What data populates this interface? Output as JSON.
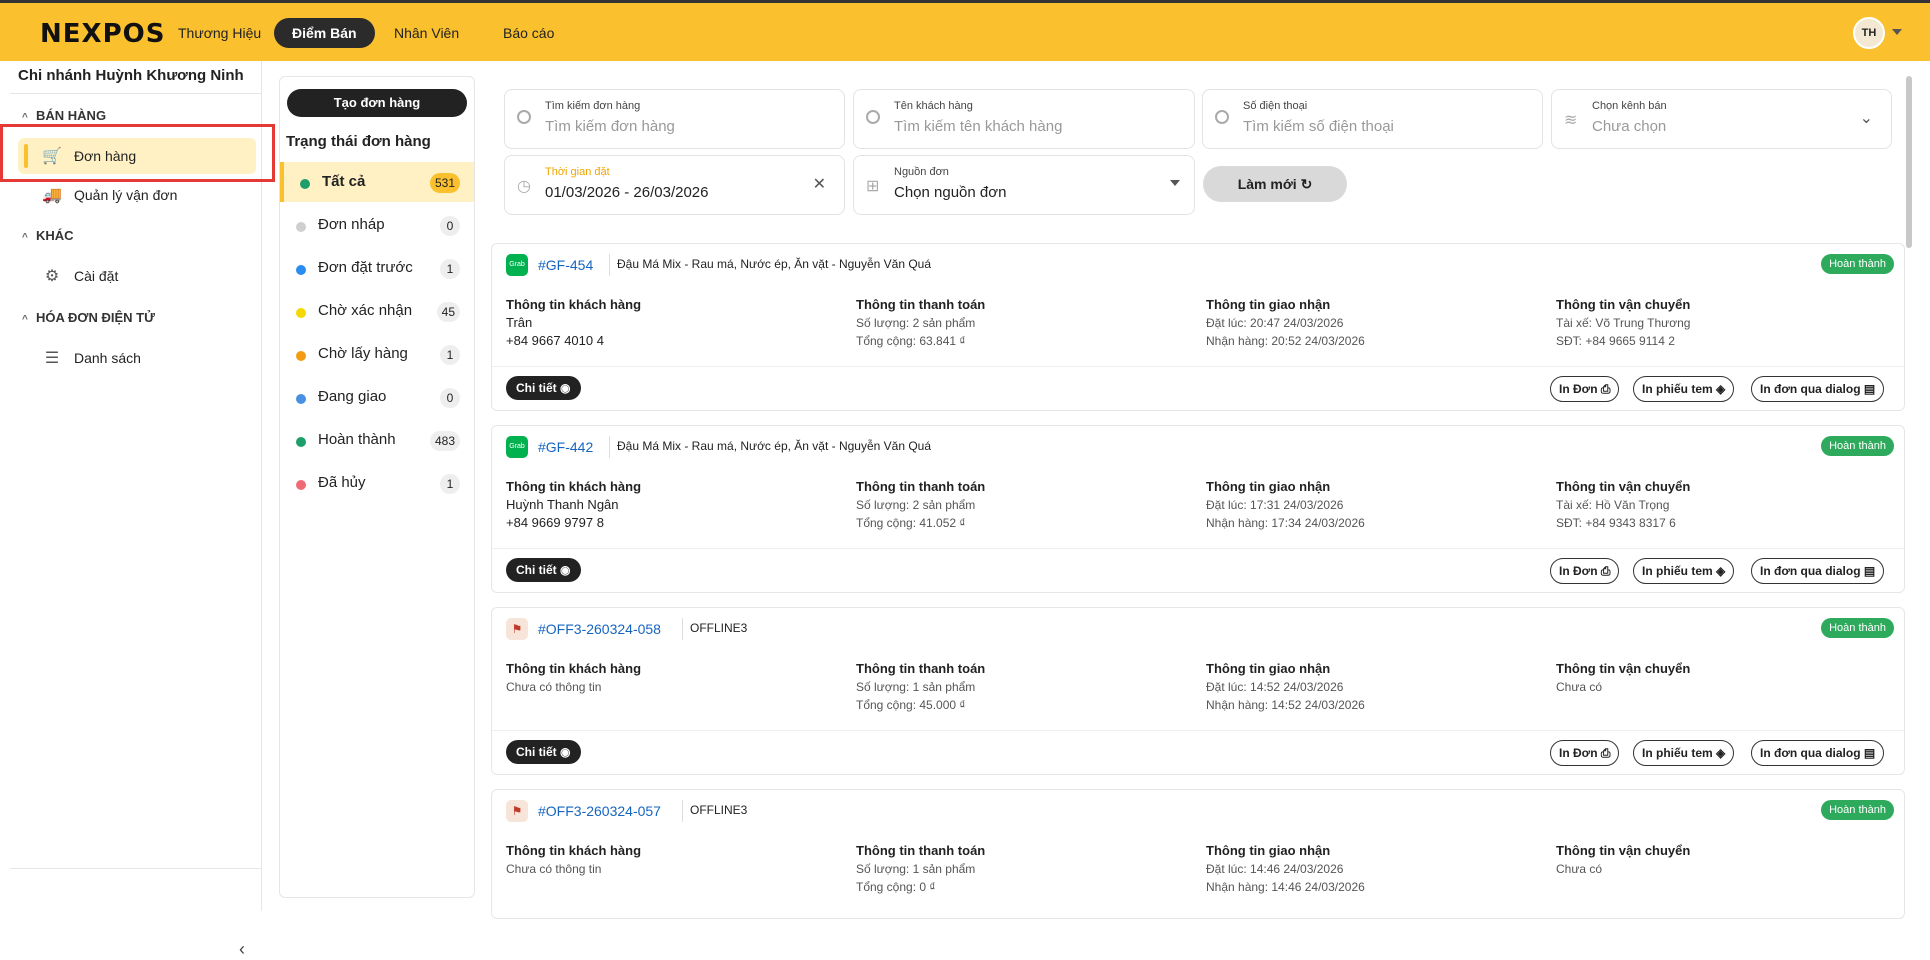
{
  "topbar": {
    "logo": "NEXPOS",
    "nav": [
      "Thương Hiệu",
      "Điểm Bán",
      "Nhân Viên",
      "Báo cáo"
    ],
    "active_nav": "Điểm Bán",
    "avatar": "TH"
  },
  "sidebar": {
    "branch": "Chi nhánh Huỳnh Khương Ninh",
    "groups": [
      {
        "title": "BÁN HÀNG",
        "items": [
          "Đơn hàng",
          "Quản lý vận đơn"
        ]
      },
      {
        "title": "KHÁC",
        "items": [
          "Cài đặt"
        ]
      },
      {
        "title": "HÓA ĐƠN ĐIỆN TỬ",
        "items": [
          "Danh sách"
        ]
      }
    ]
  },
  "status_panel": {
    "create_button": "Tạo đơn hàng",
    "title": "Trạng thái đơn hàng",
    "statuses": [
      {
        "label": "Tất cả",
        "count": "531",
        "color": "#1e9e6a"
      },
      {
        "label": "Đơn nháp",
        "count": "0",
        "color": "#cfcfcf"
      },
      {
        "label": "Đơn đặt trước",
        "count": "1",
        "color": "#2a8cf0"
      },
      {
        "label": "Chờ xác nhận",
        "count": "45",
        "color": "#f5d800"
      },
      {
        "label": "Chờ lấy hàng",
        "count": "1",
        "color": "#f39c12"
      },
      {
        "label": "Đang giao",
        "count": "0",
        "color": "#4a90e2"
      },
      {
        "label": "Hoàn thành",
        "count": "483",
        "color": "#1e9e6a"
      },
      {
        "label": "Đã hủy",
        "count": "1",
        "color": "#f06a75"
      }
    ]
  },
  "filters": {
    "order": {
      "label": "Tìm kiếm đơn hàng",
      "placeholder": "Tìm kiếm đơn hàng"
    },
    "customer": {
      "label": "Tên khách hàng",
      "placeholder": "Tìm kiếm tên khách hàng"
    },
    "phone": {
      "label": "Số điện thoại",
      "placeholder": "Tìm kiếm số điện thoại"
    },
    "channel": {
      "label": "Chọn kênh bán",
      "value": "Chưa chọn"
    },
    "time": {
      "label": "Thời gian đặt",
      "value": "01/03/2026 - 26/03/2026"
    },
    "source": {
      "label": "Nguồn đơn",
      "value": "Chọn nguồn đơn"
    },
    "refresh": "Làm mới"
  },
  "labels": {
    "customer_info": "Thông tin khách hàng",
    "payment_info": "Thông tin thanh toán",
    "delivery_info": "Thông tin giao nhận",
    "shipping_info": "Thông tin vận chuyển",
    "detail": "Chi tiết",
    "print_order": "In Đơn",
    "print_label": "In phiếu tem",
    "print_dialog": "In đơn qua dialog"
  },
  "orders": [
    {
      "code": "#GF-454",
      "source_logo": "Grab",
      "store": "Đậu Má Mix - Rau má, Nước ép, Ăn vặt - Nguyễn Văn Quá",
      "status": "Hoàn thành",
      "customer_name": "Trân",
      "customer_phone": "+84 9667 4010 4",
      "quantity": "Số lượng: 2 sản phẩm",
      "total": "Tổng cộng: 63.841 ₫",
      "ordered": "Đặt lúc: 20:47 24/03/2026",
      "received": "Nhận hàng: 20:52 24/03/2026",
      "driver": "Tài xế: Võ Trung Thương",
      "driver_phone": "SĐT: +84 9665 9114 2"
    },
    {
      "code": "#GF-442",
      "source_logo": "Grab",
      "store": "Đậu Má Mix - Rau má, Nước ép, Ăn vặt - Nguyễn Văn Quá",
      "status": "Hoàn thành",
      "customer_name": "Huỳnh Thanh Ngân",
      "customer_phone": "+84 9669 9797 8",
      "quantity": "Số lượng: 2 sản phẩm",
      "total": "Tổng cộng: 41.052 ₫",
      "ordered": "Đặt lúc: 17:31 24/03/2026",
      "received": "Nhận hàng: 17:34 24/03/2026",
      "driver": "Tài xế: Hồ Văn Trọng",
      "driver_phone": "SĐT: +84 9343 8317 6"
    },
    {
      "code": "#OFF3-260324-058",
      "source_logo": "",
      "store": "OFFLINE3",
      "status": "Hoàn thành",
      "customer_name": "Chưa có thông tin",
      "customer_phone": "",
      "quantity": "Số lượng: 1 sản phẩm",
      "total": "Tổng cộng: 45.000 ₫",
      "ordered": "Đặt lúc: 14:52 24/03/2026",
      "received": "Nhận hàng: 14:52 24/03/2026",
      "driver": "Chưa có",
      "driver_phone": ""
    },
    {
      "code": "#OFF3-260324-057",
      "source_logo": "",
      "store": "OFFLINE3",
      "status": "Hoàn thành",
      "customer_name": "Chưa có thông tin",
      "customer_phone": "",
      "quantity": "Số lượng: 1 sản phẩm",
      "total": "Tổng cộng: 0 ₫",
      "ordered": "Đặt lúc: 14:46 24/03/2026",
      "received": "Nhận hàng: 14:46 24/03/2026",
      "driver": "Chưa có",
      "driver_phone": ""
    }
  ]
}
